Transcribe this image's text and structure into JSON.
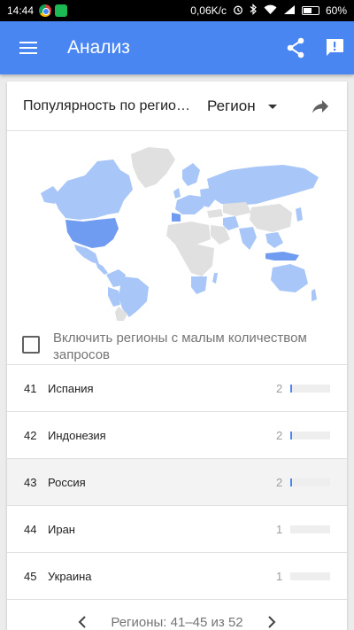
{
  "status": {
    "time": "14:44",
    "net_speed": "0,06K/c",
    "battery": "60%",
    "battery_level": 0.6
  },
  "appbar": {
    "title": "Анализ",
    "bg_color": "#4a86f1",
    "icons": [
      "menu-icon",
      "share-icon",
      "feedback-icon"
    ]
  },
  "card": {
    "title": "Популярность по регионам",
    "region_select": "Регион",
    "checkbox_label": "Включить регионы с малым количеством запросов",
    "checkbox_checked": false
  },
  "rows": [
    {
      "rank": "41",
      "name": "Испания",
      "value": "2",
      "fill": 0.04,
      "highlight": false
    },
    {
      "rank": "42",
      "name": "Индонезия",
      "value": "2",
      "fill": 0.04,
      "highlight": false
    },
    {
      "rank": "43",
      "name": "Россия",
      "value": "2",
      "fill": 0.04,
      "highlight": true
    },
    {
      "rank": "44",
      "name": "Иран",
      "value": "1",
      "fill": 0.0,
      "highlight": false
    },
    {
      "rank": "45",
      "name": "Украина",
      "value": "1",
      "fill": 0.0,
      "highlight": false
    }
  ],
  "pager": {
    "text": "Регионы: 41–45 из 52"
  },
  "map": {
    "highlight_color": "#a8c7f8",
    "strong_color": "#6f9cf0",
    "base_color": "#e0e0e0"
  }
}
